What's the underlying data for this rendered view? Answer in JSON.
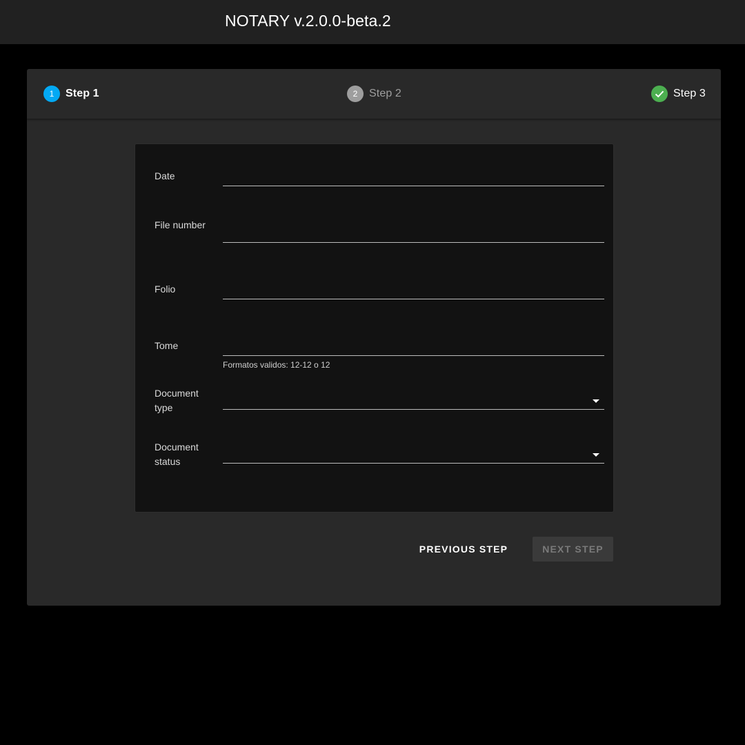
{
  "app": {
    "title": "NOTARY v.2.0.0-beta.2"
  },
  "stepper": {
    "steps": [
      {
        "number": "1",
        "label": "Step 1",
        "state": "active",
        "color": "#03a9f4"
      },
      {
        "number": "2",
        "label": "Step 2",
        "state": "inactive",
        "color": "#9e9e9e"
      },
      {
        "number": "",
        "label": "Step 3",
        "state": "complete",
        "color": "#4caf50",
        "icon": "check-icon"
      }
    ]
  },
  "form": {
    "fields": [
      {
        "label": "Date",
        "value": ""
      },
      {
        "label": "File number",
        "value": ""
      },
      {
        "label": "Folio",
        "value": ""
      },
      {
        "label": "Tome",
        "value": "",
        "hint": "Formatos validos: 12-12 o 12"
      },
      {
        "label": "Document type",
        "value": "",
        "icon": "chevron-down-icon"
      },
      {
        "label": "Document status",
        "value": "",
        "icon": "chevron-down-icon"
      }
    ]
  },
  "actions": {
    "previous_label": "PREVIOUS STEP",
    "next_label": "NEXT STEP",
    "next_disabled": true
  },
  "colors": {
    "appbar": "#212121",
    "background": "#000000",
    "card": "#292929",
    "form_card": "#121212",
    "active_step": "#03a9f4",
    "complete_step": "#4caf50"
  }
}
